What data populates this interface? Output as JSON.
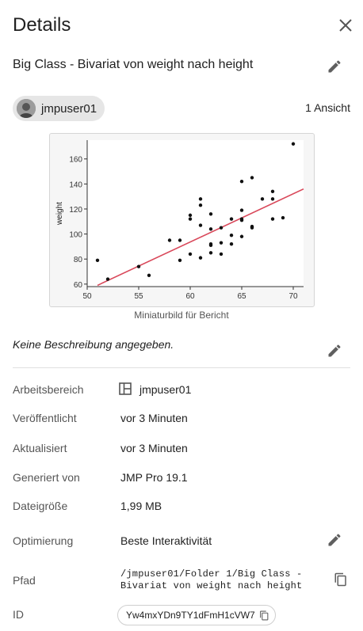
{
  "panel": {
    "title": "Details"
  },
  "report": {
    "title": "Big Class - Bivariat von weight nach height",
    "owner": "jmpuser01",
    "views": "1 Ansicht",
    "thumbnail_caption": "Miniaturbild für Bericht",
    "description": "Keine Beschreibung angegeben."
  },
  "properties": {
    "workspace": {
      "label": "Arbeitsbereich",
      "value": "jmpuser01",
      "icon": "workspace-icon"
    },
    "published": {
      "label": "Veröffentlicht",
      "value": "vor 3 Minuten"
    },
    "updated": {
      "label": "Aktualisiert",
      "value": "vor 3 Minuten"
    },
    "generated_by": {
      "label": "Generiert von",
      "value": "JMP Pro 19.1"
    },
    "file_size": {
      "label": "Dateigröße",
      "value": "1,99 MB"
    },
    "optimization": {
      "label": "Optimierung",
      "value": "Beste Interaktivität"
    },
    "path": {
      "label": "Pfad",
      "line1": "/jmpuser01/Folder 1/Big Class -",
      "line2": "Bivariat von weight nach height"
    },
    "id": {
      "label": "ID",
      "value": "Yw4mxYDn9TY1dFmH1cVW7"
    }
  },
  "icons": [
    "close-icon",
    "edit-icon",
    "avatar-icon",
    "workspace-icon",
    "copy-icon"
  ],
  "colors": {
    "fit_line": "#d9485a",
    "points": "#111111"
  },
  "chart_data": {
    "type": "scatter",
    "ylabel": "weight",
    "xlabel": "",
    "xlim": [
      50,
      71
    ],
    "ylim": [
      58,
      175
    ],
    "xticks": [
      50,
      55,
      60,
      65,
      70
    ],
    "yticks": [
      60,
      80,
      100,
      120,
      140,
      160
    ],
    "points": [
      [
        51,
        79
      ],
      [
        52,
        64
      ],
      [
        55,
        74
      ],
      [
        56,
        67
      ],
      [
        58,
        95
      ],
      [
        59,
        95
      ],
      [
        59,
        79
      ],
      [
        60,
        84
      ],
      [
        60,
        112
      ],
      [
        60,
        115
      ],
      [
        61,
        128
      ],
      [
        61,
        123
      ],
      [
        61,
        107
      ],
      [
        61,
        81
      ],
      [
        62,
        116
      ],
      [
        62,
        104
      ],
      [
        62,
        92
      ],
      [
        62,
        91
      ],
      [
        62,
        85
      ],
      [
        63,
        105
      ],
      [
        63,
        93
      ],
      [
        63,
        84
      ],
      [
        64,
        112
      ],
      [
        64,
        99
      ],
      [
        64,
        92
      ],
      [
        65,
        142
      ],
      [
        65,
        119
      ],
      [
        65,
        112
      ],
      [
        65,
        111
      ],
      [
        65,
        98
      ],
      [
        66,
        145
      ],
      [
        66,
        106
      ],
      [
        66,
        105
      ],
      [
        67,
        128
      ],
      [
        68,
        134
      ],
      [
        68,
        128
      ],
      [
        68,
        112
      ],
      [
        69,
        113
      ],
      [
        70,
        172
      ]
    ],
    "fit_line": {
      "x": [
        51,
        71
      ],
      "y": [
        59,
        136
      ]
    }
  }
}
